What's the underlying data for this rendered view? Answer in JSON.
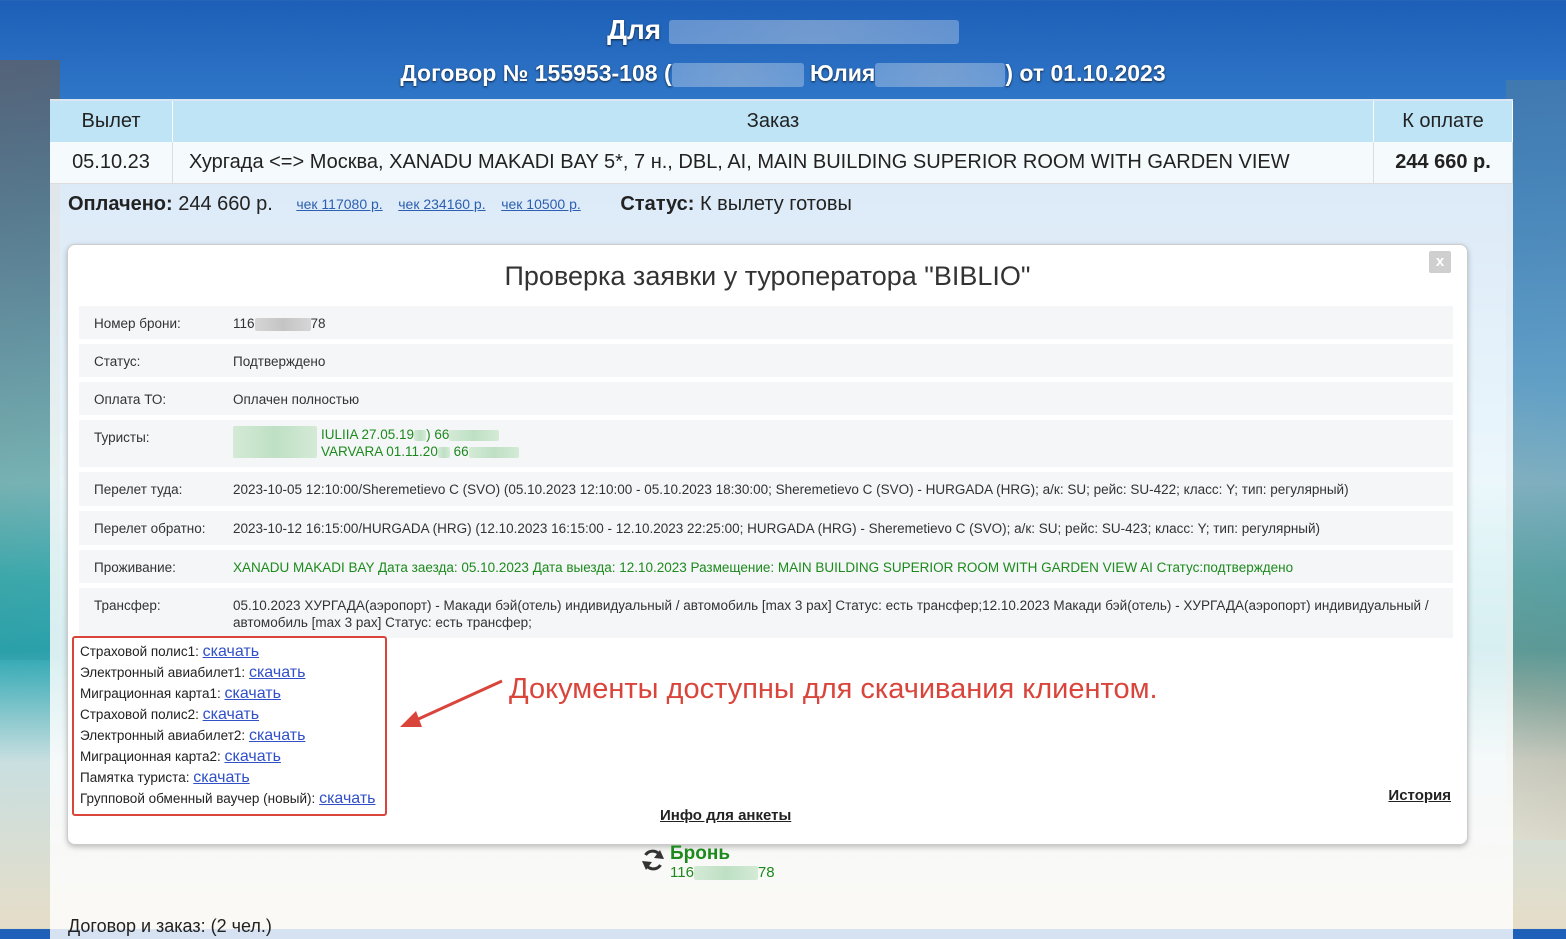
{
  "header": {
    "title_prefix": "Для",
    "contract_prefix": "Договор № 155953-108 (",
    "contract_name": "Юлия",
    "contract_suffix": ") от 01.10.2023"
  },
  "order_table": {
    "headers": [
      "Вылет",
      "Заказ",
      "К оплате"
    ],
    "row": {
      "departure": "05.10.23",
      "order": "Хургада <=> Москва, XANADU MAKADI BAY 5*, 7 н., DBL, AI, MAIN BUILDING SUPERIOR ROOM WITH GARDEN VIEW",
      "amount": "244 660 р."
    }
  },
  "payment": {
    "paid_label": "Оплачено:",
    "paid_value": "244 660 р.",
    "checks": [
      "чек 117080 р.",
      "чек 234160 р.",
      "чек 10500 р."
    ],
    "status_label": "Статус:",
    "status_value": "К вылету готовы"
  },
  "modal": {
    "close_label": "x",
    "title": "Проверка заявки у туроператора \"BIBLIO\"",
    "fields": {
      "booking_label": "Номер брони:",
      "booking_prefix": "116",
      "booking_suffix": "78",
      "status_label": "Статус:",
      "status_value": "Подтверждено",
      "payment_label": "Оплата ТО:",
      "payment_value": "Оплачен полностью",
      "tourists_label": "Туристы:",
      "tourist1_name": "IULIIA 27.05.19",
      "tourist1_doc": "66",
      "tourist2_name": "VARVARA 01.11.20",
      "tourist2_doc": "66",
      "flight_to_label": "Перелет туда:",
      "flight_to_value": "2023-10-05 12:10:00/Sheremetievo C (SVO) (05.10.2023 12:10:00 - 05.10.2023 18:30:00; Sheremetievo C (SVO) - HURGADA (HRG); а/к: SU; рейс: SU-422; класс: Y; тип: регулярный)",
      "flight_back_label": "Перелет обратно:",
      "flight_back_value": "2023-10-12 16:15:00/HURGADA (HRG) (12.10.2023 16:15:00 - 12.10.2023 22:25:00; HURGADA (HRG) - Sheremetievo C (SVO); а/к: SU; рейс: SU-423; класс: Y; тип: регулярный)",
      "hotel_label": "Проживание:",
      "hotel_value": "XANADU MAKADI BAY Дата заезда: 05.10.2023 Дата выезда: 12.10.2023 Размещение: MAIN BUILDING SUPERIOR ROOM WITH GARDEN VIEW AI Статус:подтверждено",
      "transfer_label": "Трансфер:",
      "transfer_value": "05.10.2023 ХУРГАДА(аэропорт) - Макади бэй(отель) индивидуальный / автомобиль [max 3 pax] Статус: есть трансфер;12.10.2023 Макади бэй(отель) - ХУРГАДА(аэропорт) индивидуальный / автомобиль [max 3 pax] Статус: есть трансфер;"
    },
    "documents": [
      {
        "label": "Страховой полис1:",
        "link": "скачать"
      },
      {
        "label": "Электронный авиабилет1:",
        "link": "скачать"
      },
      {
        "label": "Миграционная карта1:",
        "link": "скачать"
      },
      {
        "label": "Страховой полис2:",
        "link": "скачать"
      },
      {
        "label": "Электронный авиабилет2:",
        "link": "скачать"
      },
      {
        "label": "Миграционная карта2:",
        "link": "скачать"
      },
      {
        "label": "Памятка туриста:",
        "link": "скачать"
      },
      {
        "label": "Групповой обменный ваучер (новый):",
        "link": "скачать"
      }
    ],
    "annotation": "Документы доступны для скачивания клиентом.",
    "history_link": "История",
    "anketa_link": "Инфо для анкеты"
  },
  "booking_widget": {
    "icon": "refresh-icon",
    "title": "Бронь",
    "number_prefix": "116",
    "number_suffix": "78"
  },
  "footer": {
    "text": "Договор и заказ: (2 чел.)"
  },
  "colors": {
    "accent_red": "#d9443b",
    "green_text": "#1d8a1d",
    "link_blue": "#3150c8",
    "table_header": "#bfe4f6"
  }
}
